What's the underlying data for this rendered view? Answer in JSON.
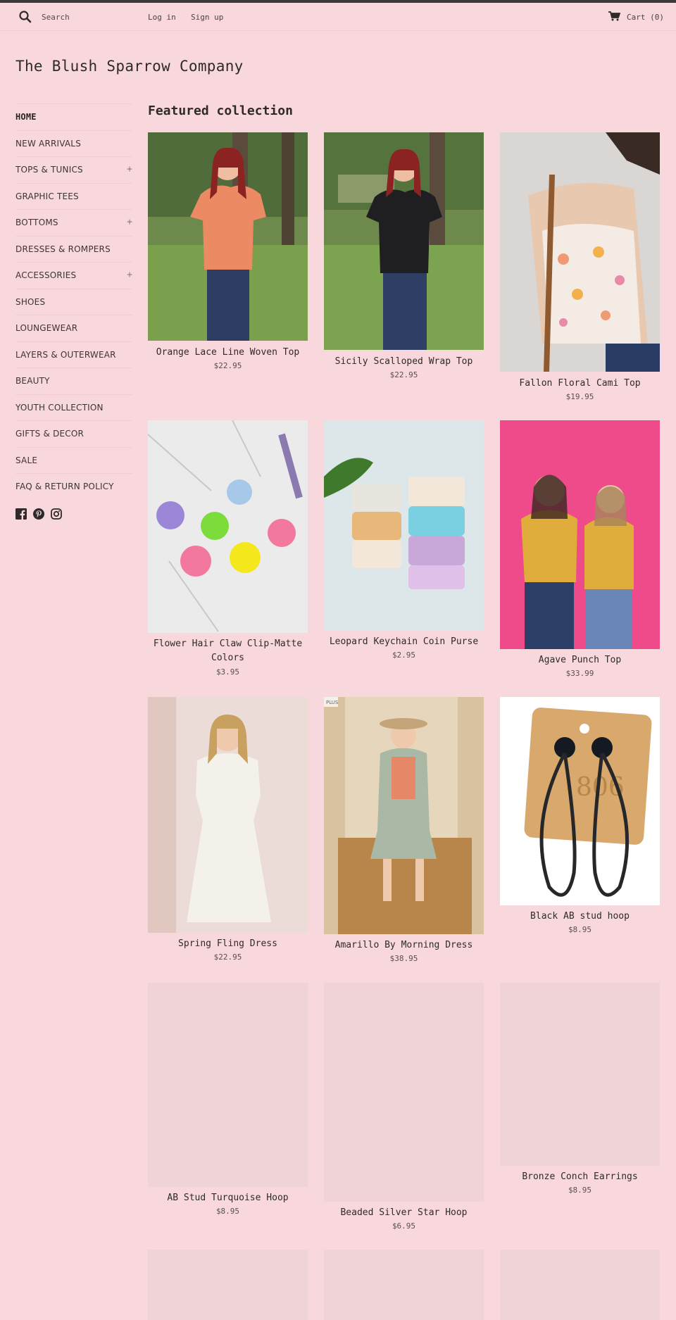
{
  "header": {
    "search_placeholder": "Search",
    "login_label": "Log in",
    "signup_label": "Sign up",
    "cart_label": "Cart (0)"
  },
  "store": {
    "title": "The Blush Sparrow Company"
  },
  "sidebar": {
    "items": [
      {
        "label": "HOME",
        "expandable": false
      },
      {
        "label": "NEW ARRIVALS",
        "expandable": false
      },
      {
        "label": "TOPS & TUNICS",
        "expandable": true
      },
      {
        "label": "GRAPHIC TEES",
        "expandable": false
      },
      {
        "label": "BOTTOMS",
        "expandable": true
      },
      {
        "label": "DRESSES & ROMPERS",
        "expandable": false
      },
      {
        "label": "ACCESSORIES",
        "expandable": true
      },
      {
        "label": "SHOES",
        "expandable": false
      },
      {
        "label": "LOUNGEWEAR",
        "expandable": false
      },
      {
        "label": "LAYERS & OUTERWEAR",
        "expandable": false
      },
      {
        "label": "BEAUTY",
        "expandable": false
      },
      {
        "label": "YOUTH COLLECTION",
        "expandable": false
      },
      {
        "label": "GIFTS & DECOR",
        "expandable": false
      },
      {
        "label": "SALE",
        "expandable": false
      },
      {
        "label": "FAQ & RETURN POLICY",
        "expandable": false
      }
    ],
    "expand_symbol": "+",
    "social_icons": [
      "facebook-icon",
      "pinterest-icon",
      "instagram-icon"
    ]
  },
  "main": {
    "section_title": "Featured collection",
    "products": [
      {
        "title": "Orange Lace Line Woven Top",
        "price": "$22.95"
      },
      {
        "title": "Sicily Scalloped Wrap Top",
        "price": "$22.95"
      },
      {
        "title": "Fallon Floral Cami Top",
        "price": "$19.95"
      },
      {
        "title": "Flower Hair Claw Clip-Matte Colors",
        "price": "$3.95"
      },
      {
        "title": "Leopard Keychain Coin Purse",
        "price": "$2.95"
      },
      {
        "title": "Agave Punch Top",
        "price": "$33.99"
      },
      {
        "title": "Spring Fling Dress",
        "price": "$22.95"
      },
      {
        "title": "Amarillo By Morning Dress",
        "price": "$38.95",
        "badge": "PLUS"
      },
      {
        "title": "Black AB stud hoop",
        "price": "$8.95",
        "card_brand": "806"
      },
      {
        "title": "AB Stud Turquoise Hoop",
        "price": "$8.95"
      },
      {
        "title": "Beaded Silver Star Hoop",
        "price": "$6.95"
      },
      {
        "title": "Bronze Conch Earrings",
        "price": "$8.95"
      }
    ]
  },
  "colors": {
    "background": "#f8d8dc",
    "text": "#3a3232",
    "placeholder": "#efd3d6"
  }
}
